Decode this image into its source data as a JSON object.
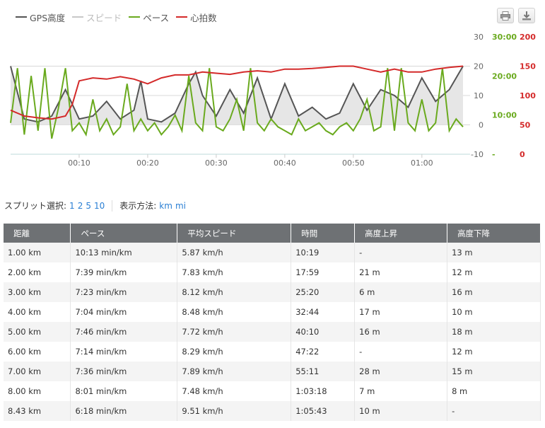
{
  "legend": [
    {
      "label": "GPS高度",
      "color": "#555555",
      "key": "altitude"
    },
    {
      "label": "スピード",
      "color": "#c8c8c8",
      "key": "speed"
    },
    {
      "label": "ペース",
      "color": "#6aaa1e",
      "key": "pace"
    },
    {
      "label": "心拍数",
      "color": "#d42a2a",
      "key": "hr"
    }
  ],
  "toolbar": {
    "print_icon": "print-icon",
    "download_icon": "download-icon"
  },
  "chart_data": {
    "type": "line",
    "x_ticks": [
      "00:10",
      "00:20",
      "00:30",
      "00:40",
      "00:50",
      "01:00"
    ],
    "y_axes": [
      {
        "name": "GPS高度",
        "ticks": [
          "30",
          "20",
          "10",
          "0",
          "-10"
        ],
        "range": [
          -10,
          30
        ],
        "color": "#555555"
      },
      {
        "name": "ペース",
        "ticks": [
          "30:00",
          "20:00",
          "10:00",
          "-"
        ],
        "color": "#6aaa1e"
      },
      {
        "name": "心拍数",
        "ticks": [
          "200",
          "150",
          "100",
          "50",
          "0"
        ],
        "range": [
          0,
          200
        ],
        "color": "#d42a2a"
      }
    ],
    "x_range_min": [
      0,
      66
    ],
    "series": [
      {
        "name": "GPS高度",
        "unit": "m",
        "x": [
          0,
          2,
          4,
          6,
          8,
          10,
          12,
          14,
          16,
          18,
          19,
          20,
          22,
          24,
          26,
          27,
          28,
          30,
          32,
          34,
          36,
          38,
          40,
          42,
          44,
          46,
          48,
          50,
          52,
          54,
          56,
          58,
          60,
          62,
          64,
          66
        ],
        "values": [
          20,
          2,
          1,
          3,
          12,
          2,
          3,
          8,
          2,
          5,
          15,
          2,
          1,
          4,
          14,
          18,
          10,
          3,
          12,
          4,
          16,
          2,
          14,
          3,
          6,
          2,
          4,
          14,
          5,
          12,
          10,
          6,
          16,
          8,
          12,
          20
        ]
      },
      {
        "name": "心拍数",
        "unit": "bpm",
        "x": [
          0,
          2,
          4,
          6,
          8,
          9,
          10,
          12,
          14,
          16,
          18,
          20,
          22,
          24,
          26,
          28,
          30,
          32,
          34,
          36,
          38,
          40,
          42,
          44,
          46,
          48,
          50,
          52,
          54,
          56,
          58,
          60,
          62,
          64,
          66
        ],
        "values": [
          75,
          65,
          62,
          60,
          65,
          85,
          125,
          130,
          128,
          132,
          128,
          120,
          130,
          135,
          135,
          140,
          138,
          136,
          140,
          142,
          140,
          145,
          145,
          146,
          148,
          150,
          150,
          145,
          140,
          145,
          140,
          140,
          145,
          148,
          150
        ]
      },
      {
        "name": "ペース",
        "unit": "min/km",
        "x": [
          0,
          1,
          2,
          3,
          4,
          5,
          6,
          7,
          8,
          9,
          10,
          11,
          12,
          13,
          14,
          15,
          16,
          17,
          18,
          19,
          20,
          21,
          22,
          23,
          24,
          25,
          26,
          27,
          28,
          29,
          30,
          31,
          32,
          33,
          34,
          35,
          36,
          37,
          38,
          39,
          40,
          41,
          42,
          43,
          44,
          45,
          46,
          47,
          48,
          49,
          50,
          51,
          52,
          53,
          54,
          55,
          56,
          57,
          58,
          59,
          60,
          61,
          62,
          63,
          64,
          65,
          66
        ],
        "values": [
          8,
          22,
          5,
          20,
          6,
          22,
          4,
          12,
          22,
          6,
          8,
          5,
          14,
          6,
          9,
          5,
          7,
          18,
          6,
          9,
          6,
          8,
          5,
          7,
          10,
          6,
          20,
          8,
          6,
          22,
          7,
          6,
          9,
          14,
          6,
          22,
          8,
          6,
          9,
          7,
          6,
          5,
          9,
          6,
          7,
          8,
          6,
          5,
          7,
          8,
          6,
          9,
          14,
          6,
          7,
          22,
          6,
          22,
          8,
          6,
          14,
          6,
          8,
          22,
          6,
          9,
          7
        ]
      }
    ]
  },
  "split_bar": {
    "label": "スプリット選択:",
    "options": [
      "1",
      "2",
      "5",
      "10"
    ],
    "unit_label": "表示方法:",
    "units": [
      "km",
      "mi"
    ]
  },
  "table": {
    "headers": [
      "距離",
      "ペース",
      "平均スピード",
      "時間",
      "高度上昇",
      "高度下降"
    ],
    "rows": [
      [
        "1.00 km",
        "10:13 min/km",
        "5.87 km/h",
        "10:19",
        "-",
        "13 m"
      ],
      [
        "2.00 km",
        "7:39 min/km",
        "7.83 km/h",
        "17:59",
        "21 m",
        "12 m"
      ],
      [
        "3.00 km",
        "7:23 min/km",
        "8.12 km/h",
        "25:20",
        "6 m",
        "16 m"
      ],
      [
        "4.00 km",
        "7:04 min/km",
        "8.48 km/h",
        "32:44",
        "17 m",
        "10 m"
      ],
      [
        "5.00 km",
        "7:46 min/km",
        "7.72 km/h",
        "40:10",
        "16 m",
        "18 m"
      ],
      [
        "6.00 km",
        "7:14 min/km",
        "8.29 km/h",
        "47:22",
        "-",
        "12 m"
      ],
      [
        "7.00 km",
        "7:36 min/km",
        "7.89 km/h",
        "55:11",
        "28 m",
        "15 m"
      ],
      [
        "8.00 km",
        "8:01 min/km",
        "7.48 km/h",
        "1:03:18",
        "7 m",
        "8 m"
      ],
      [
        "8.43 km",
        "6:18 min/km",
        "9.51 km/h",
        "1:05:43",
        "10 m",
        "-"
      ]
    ]
  }
}
